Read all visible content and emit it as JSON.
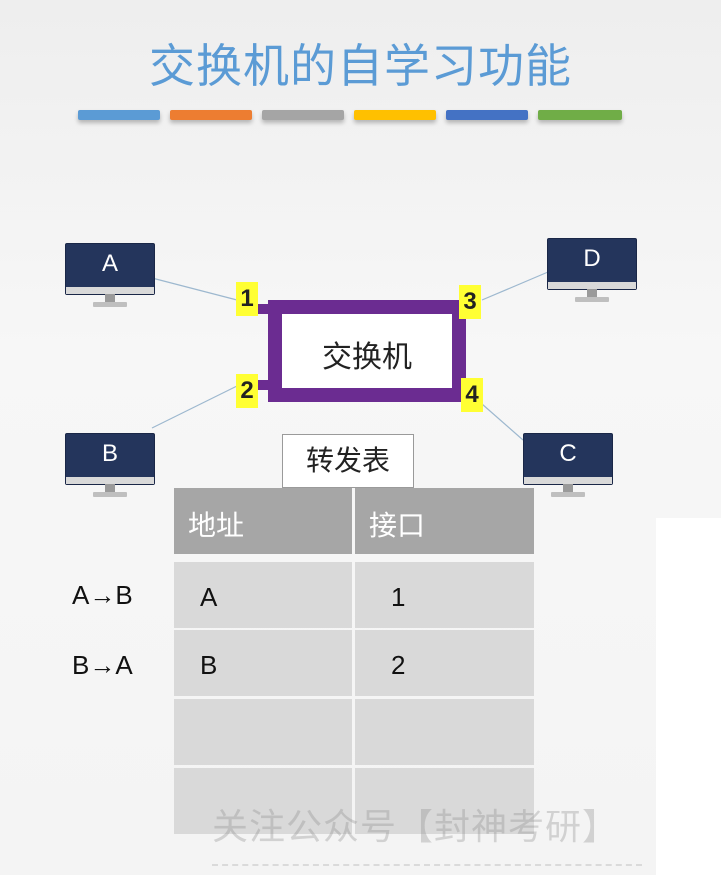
{
  "title": "交换机的自学习功能",
  "colors": {
    "title": "#5b9bd5",
    "switch": "#6b2c91",
    "port_highlight": "#ffff33",
    "bars": [
      "#5b9bd5",
      "#ed7d31",
      "#a5a5a5",
      "#ffc000",
      "#4472c4",
      "#70ad47"
    ]
  },
  "switch": {
    "label": "交换机"
  },
  "ports": [
    "1",
    "2",
    "3",
    "4"
  ],
  "hosts": [
    {
      "id": "A",
      "port": "1"
    },
    {
      "id": "B",
      "port": "2"
    },
    {
      "id": "D",
      "port": "3"
    },
    {
      "id": "C",
      "port": "4"
    }
  ],
  "forwarding_table": {
    "title": "转发表",
    "headers": [
      "地址",
      "接口"
    ],
    "rows": [
      {
        "address": "A",
        "interface": "1"
      },
      {
        "address": "B",
        "interface": "2"
      },
      {
        "address": "",
        "interface": ""
      },
      {
        "address": "",
        "interface": ""
      }
    ]
  },
  "events": [
    "A→B",
    "B→A"
  ],
  "watermark": "关注公众号【封神考研】"
}
